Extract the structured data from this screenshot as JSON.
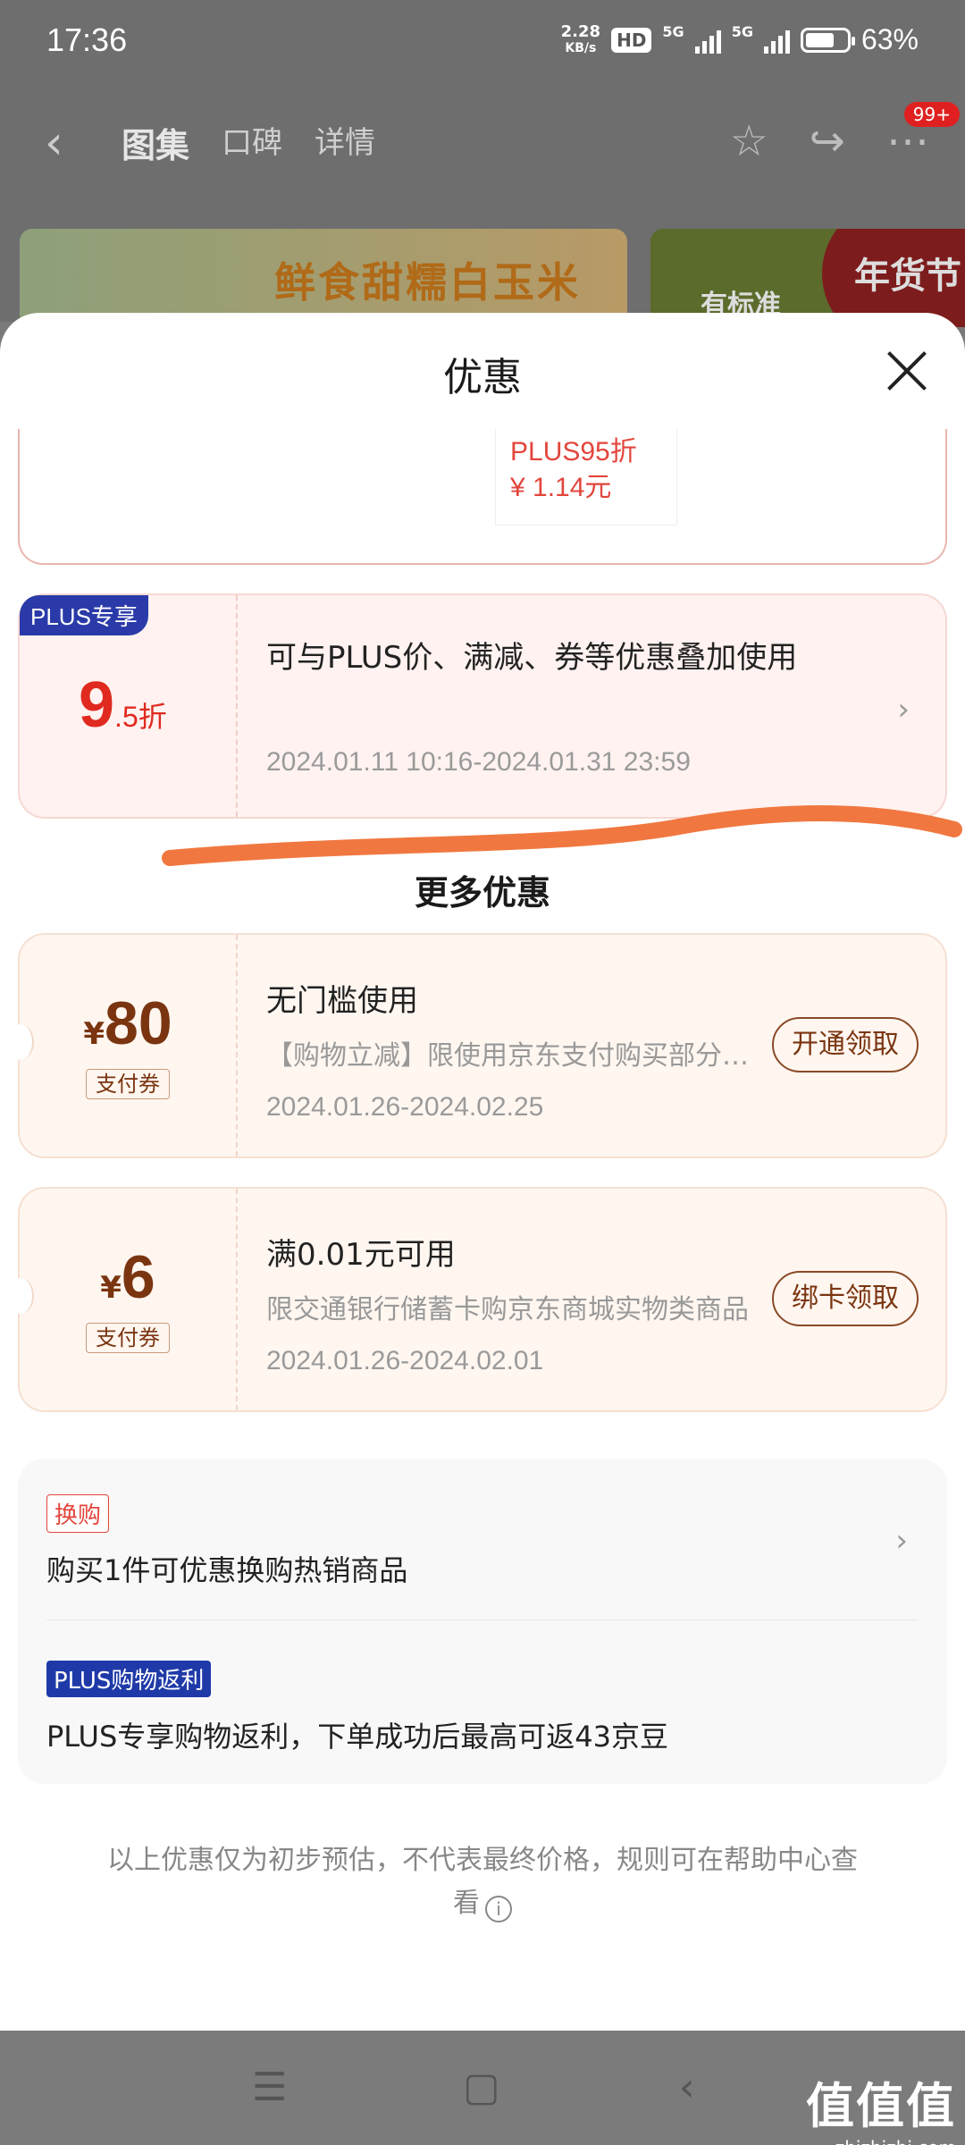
{
  "status_bar": {
    "time": "17:36",
    "speed_top": "2.28",
    "speed_bottom": "KB/s",
    "hd": "HD",
    "net1": "5G",
    "net2": "5G",
    "battery_pct": "63%"
  },
  "top_nav": {
    "tabs": [
      "图集",
      "口碑",
      "详情"
    ],
    "badge": "99+"
  },
  "banners": {
    "left_text": "鲜食甜糯白玉米",
    "right_text": "有标准",
    "right_seal": "年货节"
  },
  "sheet": {
    "title": "优惠",
    "prev_card": {
      "line1": "PLUS95折",
      "line2": "¥ 1.14元"
    },
    "plus_card": {
      "tag": "PLUS专享",
      "discount_big": "9",
      "discount_small": ".5折",
      "desc": "可与PLUS价、满减、券等优惠叠加使用",
      "date": "2024.01.11 10:16-2024.01.31 23:59"
    },
    "more_title": "更多优惠",
    "coupons": [
      {
        "yen": "¥",
        "amount": "80",
        "tag": "支付券",
        "title": "无门槛使用",
        "desc": "【购物立减】限使用京东支付购买部分商品",
        "date": "2024.01.26-2024.02.25",
        "button": "开通领取"
      },
      {
        "yen": "¥",
        "amount": "6",
        "tag": "支付券",
        "title": "满0.01元可用",
        "desc": "限交通银行储蓄卡购京东商城实物类商品",
        "date": "2024.01.26-2024.02.01",
        "button": "绑卡领取"
      }
    ],
    "other": {
      "tag1": "换购",
      "line1": "购买1件可优惠换购热销商品",
      "tag2": "PLUS购物返利",
      "line2": "PLUS专享购物返利，下单成功后最高可返43京豆"
    },
    "footnote": "以上优惠仅为初步预估，不代表最终价格，规则可在帮助中心查看"
  },
  "watermark": {
    "main": "值值值",
    "sub": "zhizhizhi.com"
  },
  "colors": {
    "accent_red": "#e02a20",
    "coupon_brown": "#7a3510",
    "plus_blue": "#2a3aa8",
    "swoosh": "#f07840"
  }
}
